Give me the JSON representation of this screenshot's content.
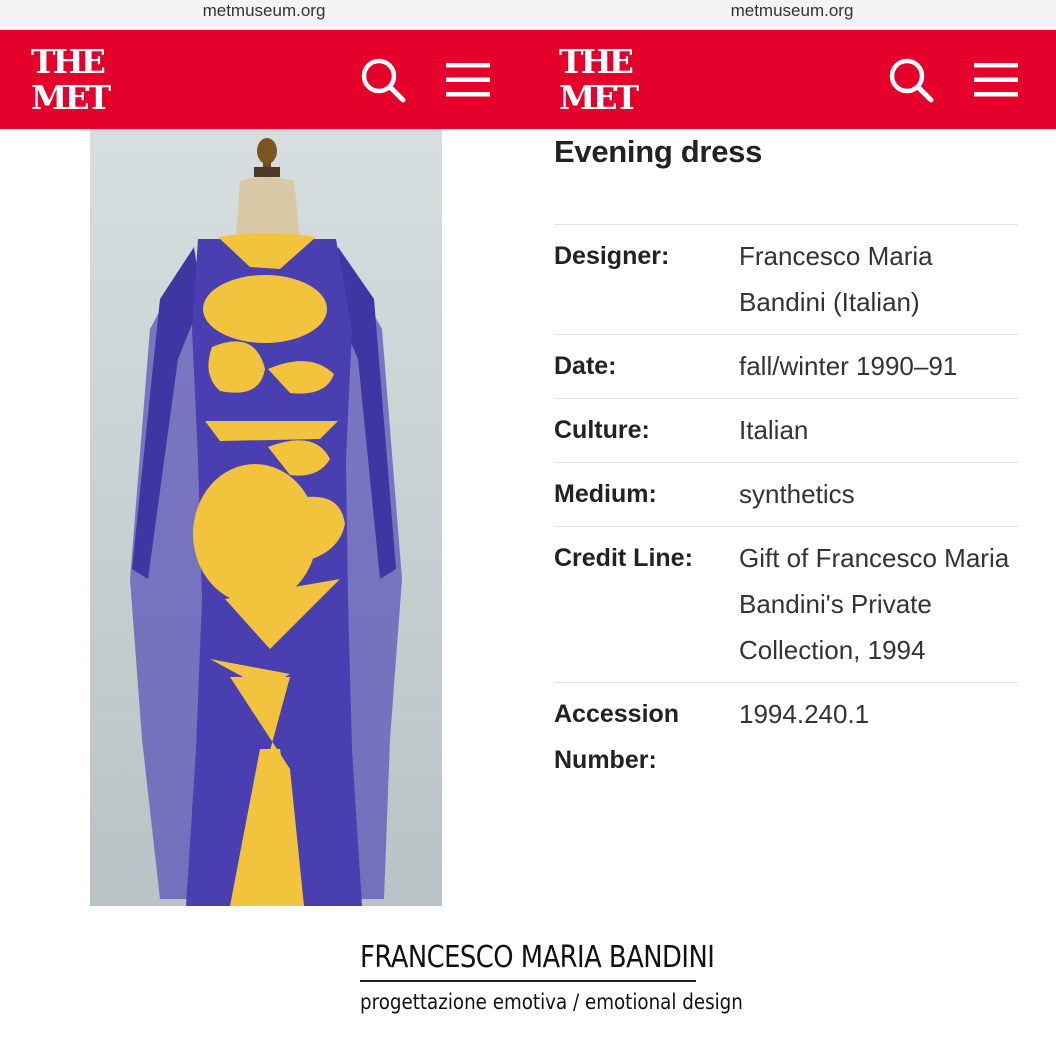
{
  "browser": {
    "url_left": "metmuseum.org",
    "url_right": "metmuseum.org"
  },
  "header": {
    "logo_line1": "THE",
    "logo_line2": "MET",
    "brand_color": "#e4002b",
    "icons": [
      "search-icon",
      "hamburger-menu-icon"
    ]
  },
  "object": {
    "title": "Evening dress",
    "details": [
      {
        "label": "Designer:",
        "value": "Francesco Maria Bandini (Italian)"
      },
      {
        "label": "Date:",
        "value": "fall/winter 1990–91"
      },
      {
        "label": "Culture:",
        "value": "Italian"
      },
      {
        "label": "Medium:",
        "value": "synthetics"
      },
      {
        "label": "Credit Line:",
        "value": "Gift of Francesco Maria Bandini's Private Collection, 1994"
      },
      {
        "label": "Accession Number:",
        "value": "1994.240.1"
      }
    ]
  },
  "footer": {
    "brand": "FRANCESCO MARIA BANDINI",
    "tagline": "progettazione emotiva / emotional design"
  },
  "colors": {
    "dress_blue": "#4a3fb0",
    "dress_yellow": "#f2c33c",
    "photo_bg": "#c9d1d3"
  }
}
